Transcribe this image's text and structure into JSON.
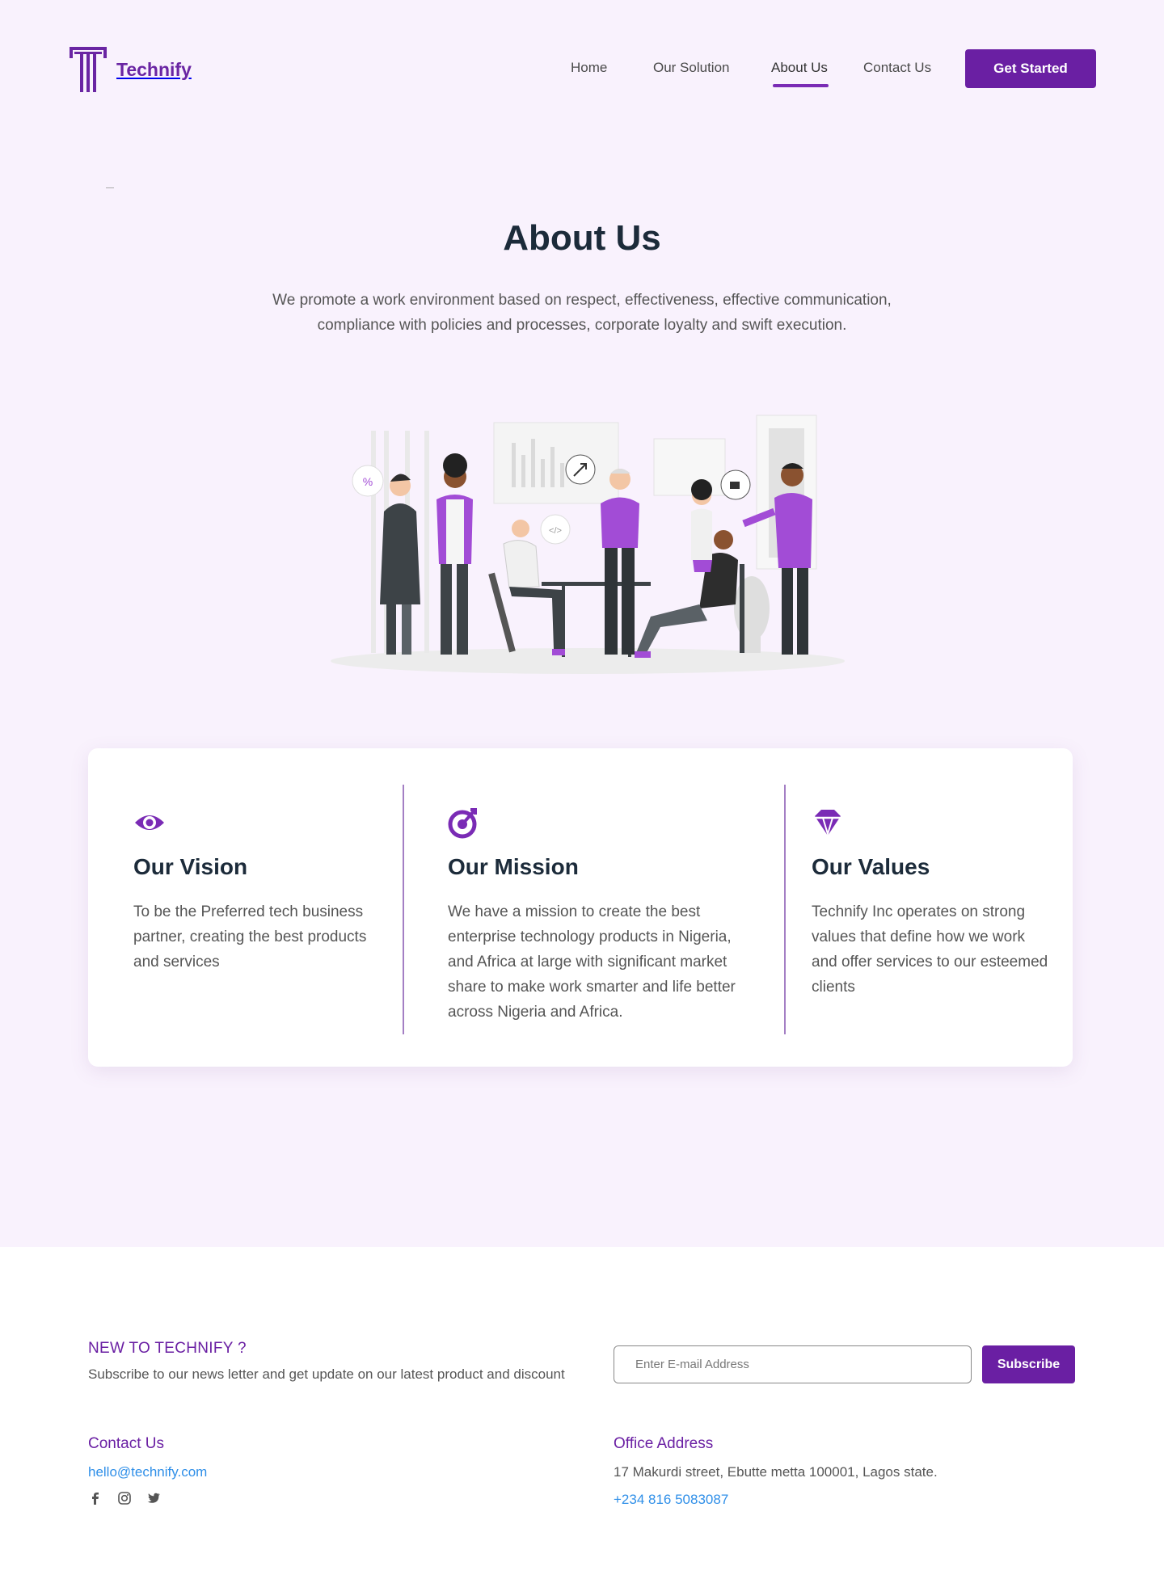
{
  "brand": {
    "name": "Technify",
    "color": "#6a25a3"
  },
  "nav": {
    "items": [
      {
        "label": "Home"
      },
      {
        "label": "Our Solution"
      },
      {
        "label": "About Us"
      },
      {
        "label": "Contact Us"
      }
    ],
    "active": "About Us",
    "cta_label": "Get Started"
  },
  "hero": {
    "title": "About Us",
    "lead_line1": "We promote a work environment based on respect, effectiveness, effective communication,",
    "lead_line2": "compliance with policies and processes, corporate loyalty and swift execution.",
    "illustration_icons": {
      "percent_bubble": "%",
      "code_bubble": "</>"
    }
  },
  "cards": [
    {
      "icon": "eye-icon",
      "title": "Our Vision",
      "text": "To be the Preferred tech business partner, creating the best products and services"
    },
    {
      "icon": "target-icon",
      "title": "Our Mission",
      "text": "We have a mission to create the best enterprise technology products in Nigeria, and Africa at large  with significant market share to make work smarter and life better across Nigeria and Africa."
    },
    {
      "icon": "diamond-icon",
      "title": "Our Values",
      "text": "Technify Inc  operates on strong values that define how we work and offer services to our esteemed clients"
    }
  ],
  "newsletter": {
    "title": "NEW TO TECHNIFY ?",
    "subtitle": "Subscribe to our news letter and get update on our latest product and discount",
    "placeholder": "Enter E-mail Address",
    "button": "Subscribe"
  },
  "footer": {
    "contact_title": "Contact Us",
    "email": "hello@technify.com",
    "social": [
      "facebook-icon",
      "instagram-icon",
      "twitter-icon"
    ],
    "office_title": "Office Address",
    "address": "17 Makurdi street, Ebutte metta 100001, Lagos state.",
    "phone": "+234 816 5083087"
  },
  "colors": {
    "accent": "#6a1fa3",
    "hero_bg": "#f9f2fd",
    "link": "#2f8fe8",
    "heading": "#1c2b3a"
  }
}
